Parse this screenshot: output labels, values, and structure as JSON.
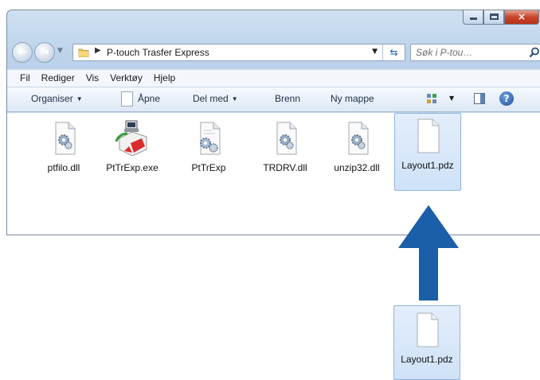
{
  "window": {
    "caption_buttons": {
      "minimize": "—",
      "maximize": "□",
      "close": "×"
    }
  },
  "navigation": {
    "back_icon": "back-arrow-icon",
    "forward_icon": "forward-arrow-icon",
    "address_path": "P-touch Trasfer Express",
    "search_placeholder": "Søk i P-tou…"
  },
  "menu": {
    "items": [
      "Fil",
      "Rediger",
      "Vis",
      "Verktøy",
      "Hjelp"
    ]
  },
  "toolbar": {
    "organize": "Organiser",
    "open": "Åpne",
    "share": "Del med",
    "burn": "Brenn",
    "new_folder": "Ny mappe"
  },
  "files": [
    {
      "name": "ptfilo.dll",
      "icon": "dll-gear-icon"
    },
    {
      "name": "PtTrExp.exe",
      "icon": "application-exe-icon"
    },
    {
      "name": "PtTrExp",
      "icon": "config-gear-icon"
    },
    {
      "name": "TRDRV.dll",
      "icon": "dll-gear-icon"
    },
    {
      "name": "unzip32.dll",
      "icon": "dll-gear-icon"
    },
    {
      "name": "Layout1.pdz",
      "icon": "blank-document-icon",
      "selected": true
    }
  ],
  "dragged_file": {
    "name": "Layout1.pdz",
    "icon": "blank-document-icon"
  },
  "colors": {
    "arrow": "#1b5fa9",
    "selection": "#cfe2f8",
    "frame": "#bcd2ea"
  }
}
